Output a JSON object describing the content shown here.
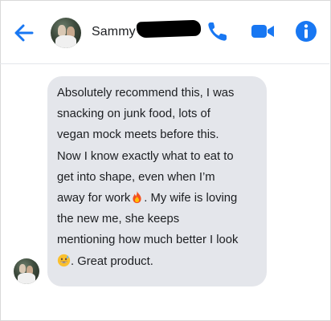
{
  "header": {
    "contact_name": "Sammy",
    "icons": [
      "back-arrow-icon",
      "phone-icon",
      "video-camera-icon",
      "info-icon"
    ]
  },
  "message": {
    "line1": "Absolutely recommend this, I was",
    "line2": "snacking on junk food, lots of",
    "line3": "vegan mock meets before this.",
    "line4": "Now I know exactly what to eat to",
    "line5": "get into shape, even when I’m",
    "line6_before": "away for work",
    "line6_after": ". My wife is loving",
    "line7": "the new me, she keeps",
    "line8": "mentioning how much better I look",
    "line9_after": ". Great product.",
    "emoji1": "fire-emoji",
    "emoji2": "grinning-sweat-emoji"
  },
  "colors": {
    "accent": "#1877f2",
    "bubble": "#e4e6eb",
    "text": "#1c1e21"
  }
}
